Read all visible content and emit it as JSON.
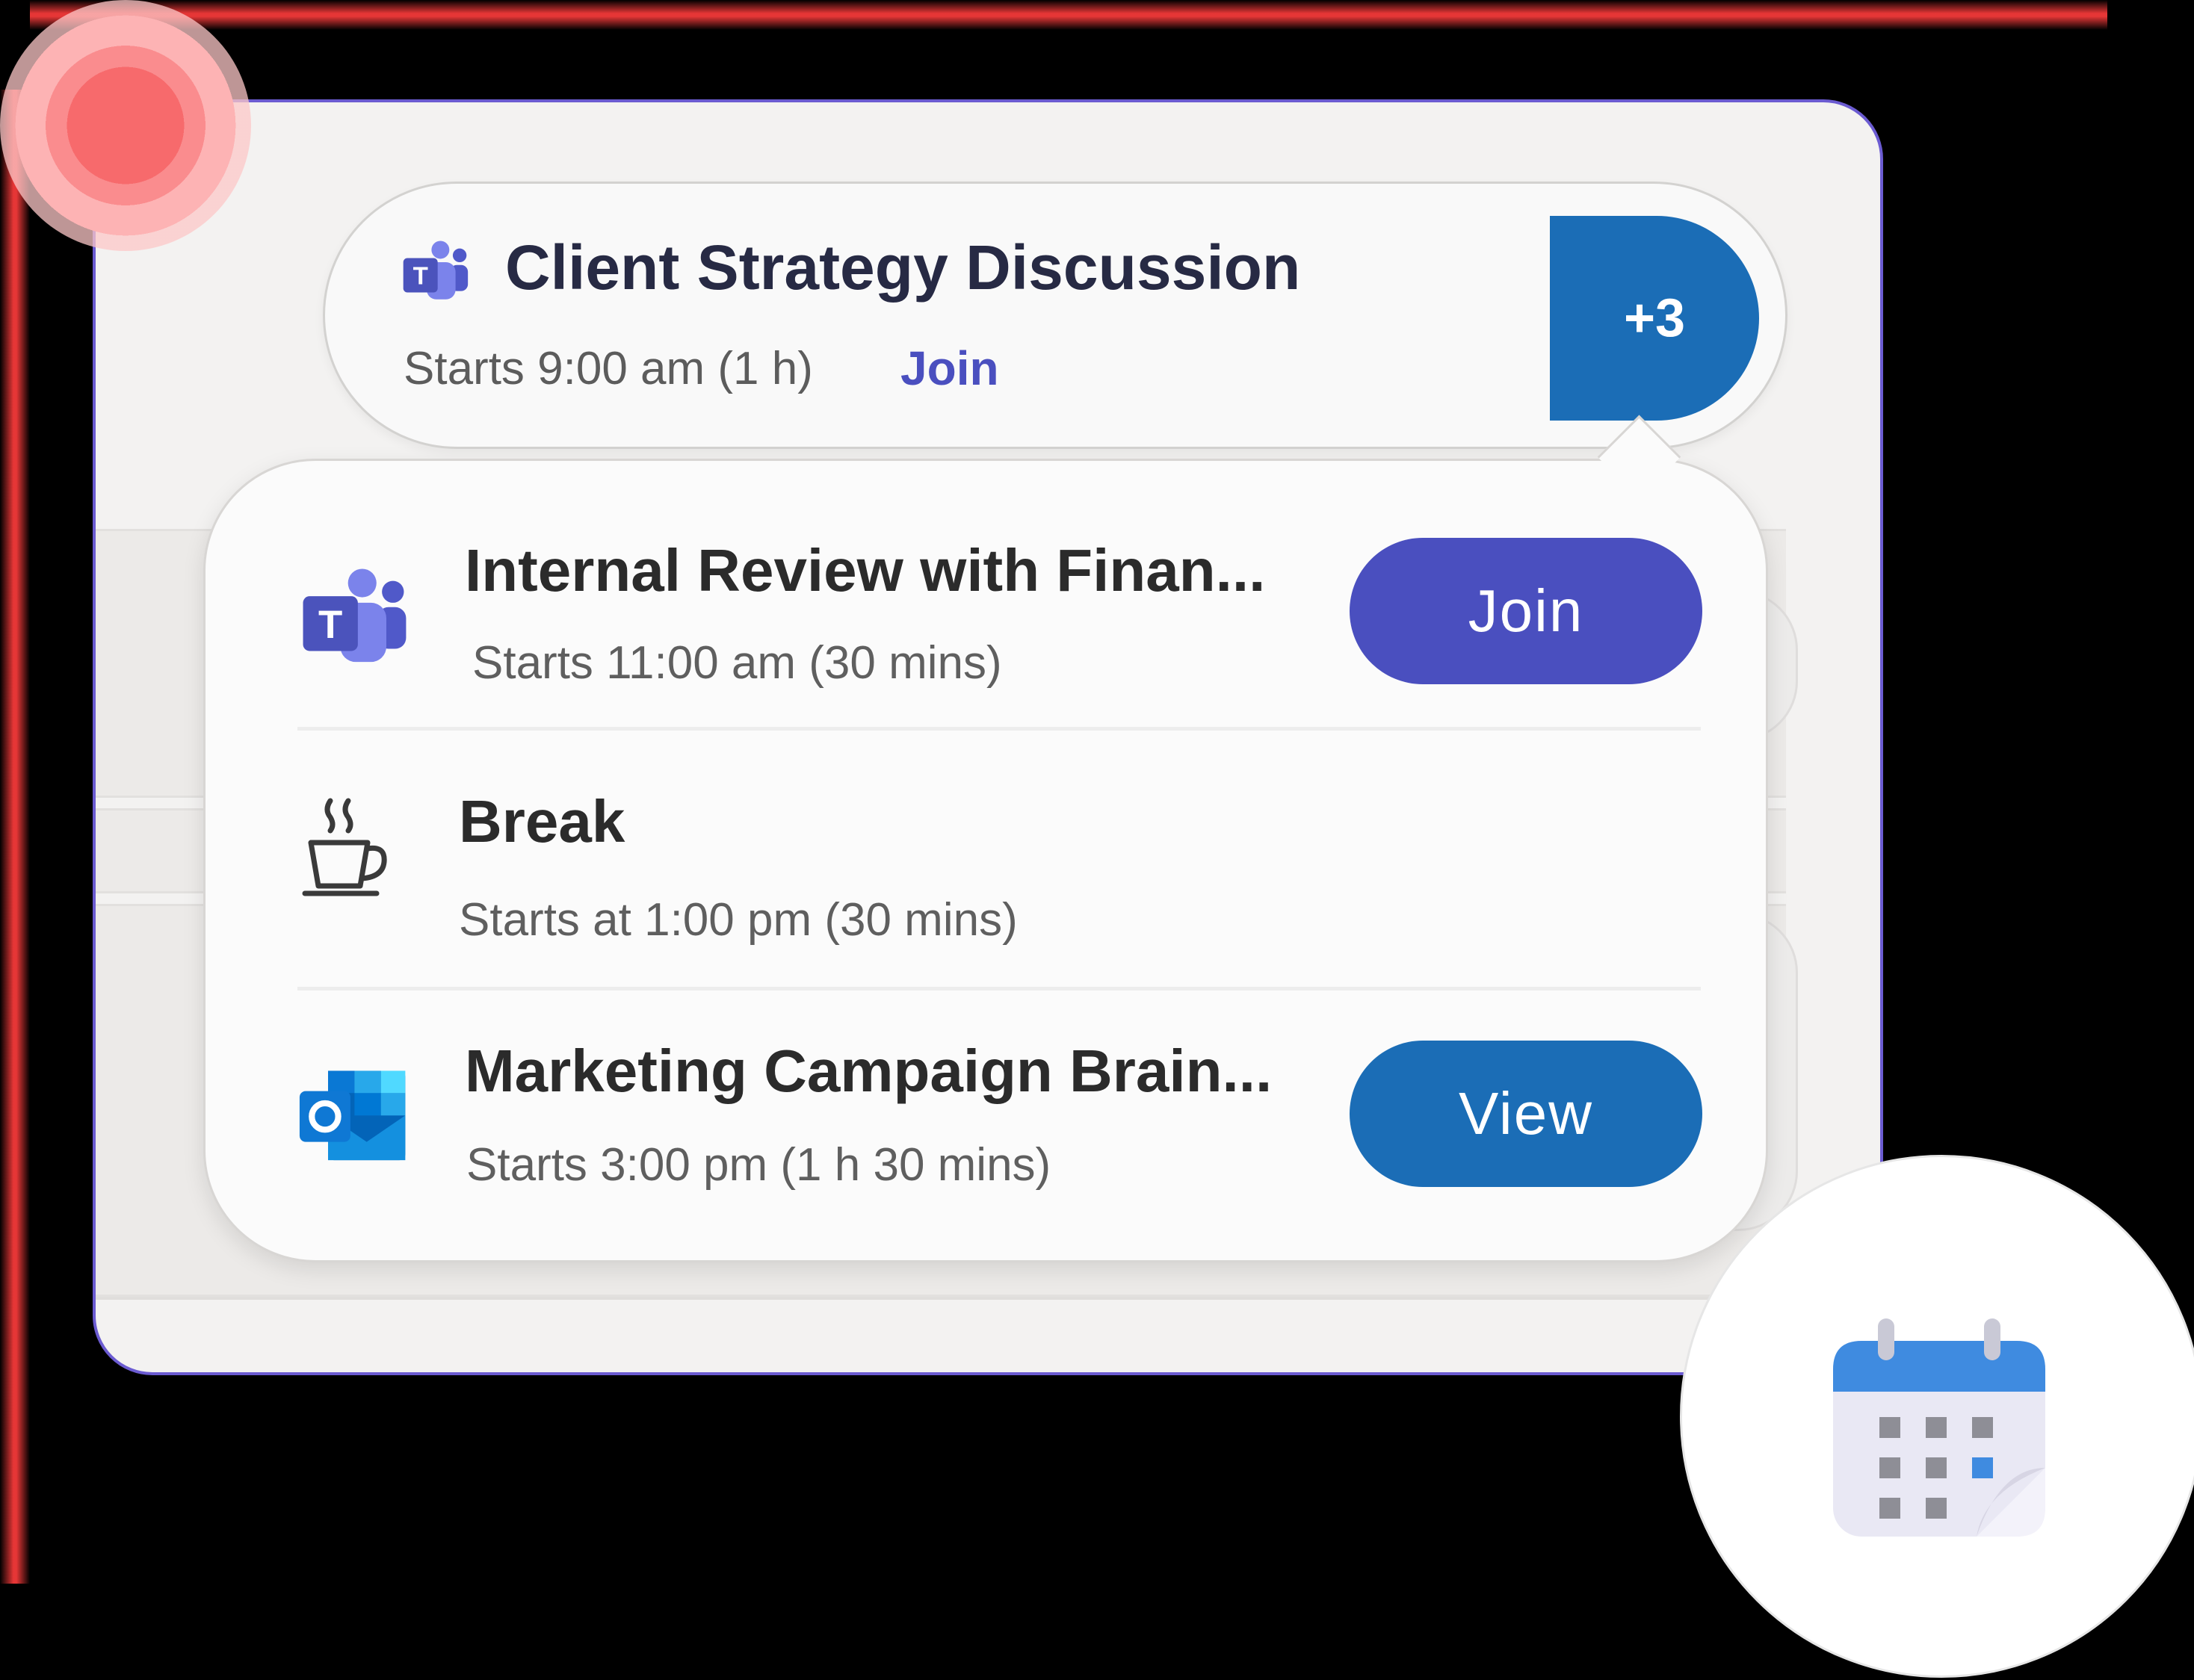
{
  "main_event": {
    "title": "Client Strategy Discussion",
    "time": "Starts 9:00 am (1 h)",
    "join_label": "Join",
    "more_label": "+3"
  },
  "popover": {
    "items": [
      {
        "icon": "teams-icon",
        "title": "Internal Review with Finan...",
        "time": "Starts 11:00 am (30 mins)",
        "action_label": "Join"
      },
      {
        "icon": "coffee-cup-icon",
        "title": "Break",
        "time": "Starts at 1:00 pm (30 mins)"
      },
      {
        "icon": "outlook-icon",
        "title": "Marketing Campaign Brain...",
        "time": "Starts 3:00 pm (1 h 30 mins)",
        "action_label": "View"
      }
    ]
  },
  "colors": {
    "teams_purple": "#4a4fbf",
    "outlook_blue": "#1b6db6",
    "card_border": "#6b5bd1",
    "accent_red": "#f76a6c"
  }
}
